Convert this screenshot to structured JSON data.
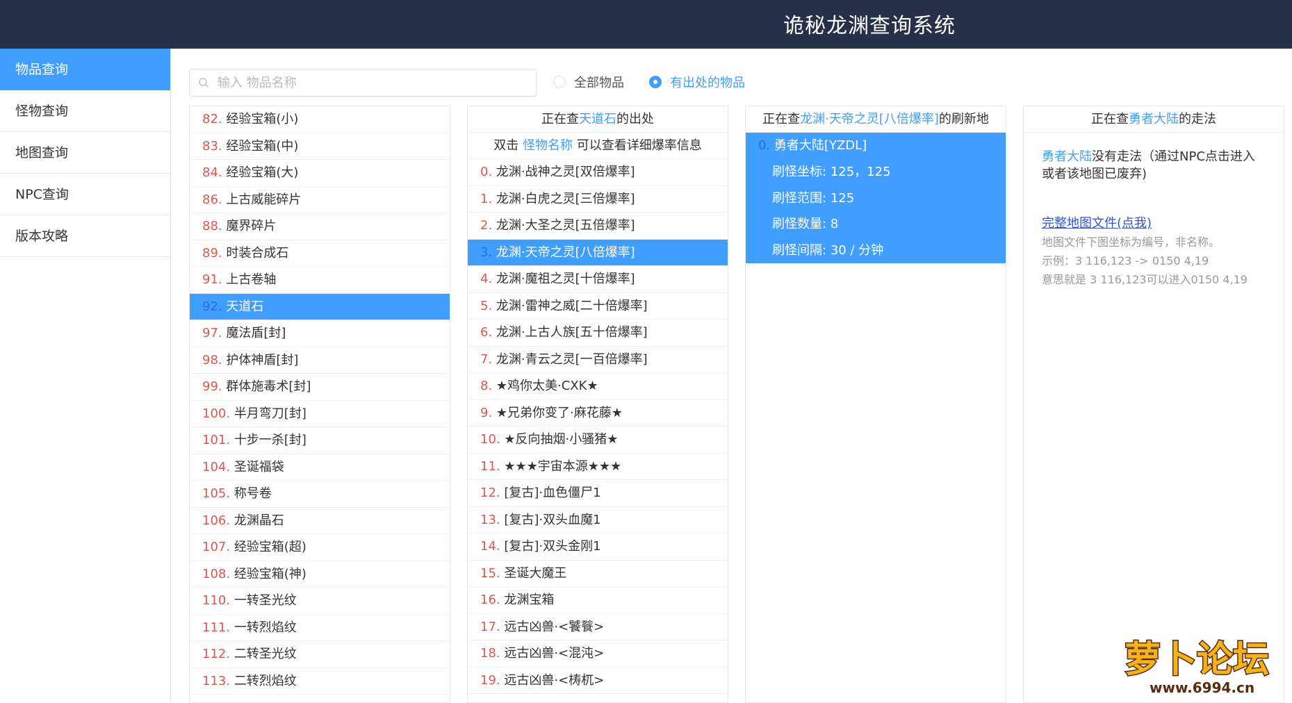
{
  "header": {
    "title": "诡秘龙渊查询系统"
  },
  "sidebar": {
    "items": [
      {
        "label": "物品查询",
        "active": true
      },
      {
        "label": "怪物查询"
      },
      {
        "label": "地图查询"
      },
      {
        "label": "NPC查询"
      },
      {
        "label": "版本攻略"
      }
    ]
  },
  "search": {
    "placeholder": "输入 物品名称",
    "value": ""
  },
  "filters": [
    {
      "label": "全部物品",
      "selected": false
    },
    {
      "label": "有出处的物品",
      "selected": true
    }
  ],
  "items": [
    {
      "idx": "82.",
      "name": "经验宝箱(小)"
    },
    {
      "idx": "83.",
      "name": "经验宝箱(中)"
    },
    {
      "idx": "84.",
      "name": "经验宝箱(大)"
    },
    {
      "idx": "86.",
      "name": "上古威能碎片"
    },
    {
      "idx": "88.",
      "name": "魔界碎片"
    },
    {
      "idx": "89.",
      "name": "时装合成石"
    },
    {
      "idx": "91.",
      "name": "上古卷轴"
    },
    {
      "idx": "92.",
      "name": "天道石",
      "selected": true
    },
    {
      "idx": "97.",
      "name": "魔法盾[封]"
    },
    {
      "idx": "98.",
      "name": "护体神盾[封]"
    },
    {
      "idx": "99.",
      "name": "群体施毒术[封]"
    },
    {
      "idx": "100.",
      "name": "半月弯刀[封]"
    },
    {
      "idx": "101.",
      "name": "十步一杀[封]"
    },
    {
      "idx": "104.",
      "name": "圣诞福袋"
    },
    {
      "idx": "105.",
      "name": "称号卷"
    },
    {
      "idx": "106.",
      "name": "龙渊晶石"
    },
    {
      "idx": "107.",
      "name": "经验宝箱(超)"
    },
    {
      "idx": "108.",
      "name": "经验宝箱(神)"
    },
    {
      "idx": "110.",
      "name": "一转圣光纹"
    },
    {
      "idx": "111.",
      "name": "一转烈焰纹"
    },
    {
      "idx": "112.",
      "name": "二转圣光纹"
    },
    {
      "idx": "113.",
      "name": "二转烈焰纹"
    }
  ],
  "sources": {
    "head_prefix": "正在查",
    "head_item": "天道石",
    "head_suffix": "的出处",
    "sub_prefix": "双击 ",
    "sub_link": "怪物名称",
    "sub_suffix": " 可以查看详细爆率信息",
    "rows": [
      {
        "idx": "0.",
        "name": "龙渊·战神之灵[双倍爆率]"
      },
      {
        "idx": "1.",
        "name": "龙渊·白虎之灵[三倍爆率]"
      },
      {
        "idx": "2.",
        "name": "龙渊·大圣之灵[五倍爆率]"
      },
      {
        "idx": "3.",
        "name": "龙渊·天帝之灵[八倍爆率]",
        "selected": true
      },
      {
        "idx": "4.",
        "name": "龙渊·魔祖之灵[十倍爆率]"
      },
      {
        "idx": "5.",
        "name": "龙渊·雷神之威[二十倍爆率]"
      },
      {
        "idx": "6.",
        "name": "龙渊·上古人族[五十倍爆率]"
      },
      {
        "idx": "7.",
        "name": "龙渊·青云之灵[一百倍爆率]"
      },
      {
        "idx": "8.",
        "name": "★鸡你太美·CXK★"
      },
      {
        "idx": "9.",
        "name": "★兄弟你变了·麻花藤★"
      },
      {
        "idx": "10.",
        "name": "★反向抽烟·小骚猪★"
      },
      {
        "idx": "11.",
        "name": "★★★宇宙本源★★★"
      },
      {
        "idx": "12.",
        "name": "[复古]·血色僵尸1"
      },
      {
        "idx": "13.",
        "name": "[复古]·双头血魔1"
      },
      {
        "idx": "14.",
        "name": "[复古]·双头金刚1"
      },
      {
        "idx": "15.",
        "name": "圣诞大魔王"
      },
      {
        "idx": "16.",
        "name": "龙渊宝箱"
      },
      {
        "idx": "17.",
        "name": "远古凶兽·<饕餮>"
      },
      {
        "idx": "18.",
        "name": "远古凶兽·<混沌>"
      },
      {
        "idx": "19.",
        "name": "远古凶兽·<梼杌>"
      }
    ]
  },
  "spawn": {
    "head_prefix": "正在查",
    "head_item": "龙渊·天帝之灵[八倍爆率]",
    "head_suffix": "的刷新地",
    "map_idx": "0.",
    "map_name": "勇者大陆[YZDL]",
    "coord_label": "刷怪坐标:",
    "coord_value": "125，125",
    "range_label": "刷怪范围:",
    "range_value": "125",
    "count_label": "刷怪数量:",
    "count_value": "8",
    "interval_label": "刷怪间隔:",
    "interval_value": "30 / 分钟"
  },
  "route": {
    "head_prefix": "正在查",
    "head_item": "勇者大陆",
    "head_suffix": "的走法",
    "map_name": "勇者大陆",
    "text": "没有走法（通过NPC点击进入或者该地图已废弃)",
    "link": "完整地图文件(点我)",
    "note1": "地图文件下图坐标为编号，非名称。",
    "note2": "示例：3 116,123 -> 0150 4,19",
    "note3": "意思就是 3 116,123可以进入0150 4,19"
  },
  "watermark": {
    "text": "萝卜论坛",
    "url": "www.6994.cn"
  },
  "colors": {
    "accent": "#409eff",
    "header_bg": "#263048",
    "index_red": "#e0574f"
  }
}
